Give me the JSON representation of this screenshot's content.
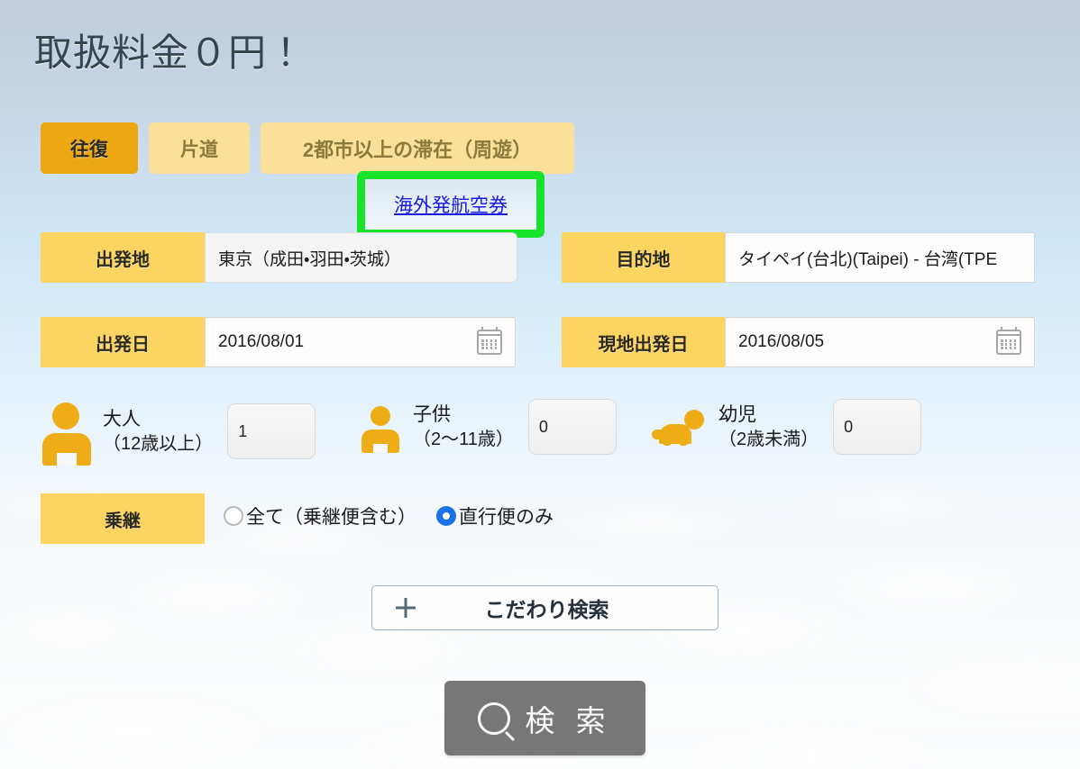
{
  "page": {
    "title": "取扱料金０円！"
  },
  "trip_tabs": [
    {
      "label": "往復",
      "active": true
    },
    {
      "label": "片道",
      "active": false
    },
    {
      "label": "2都市以上の滞在（周遊）",
      "active": false
    }
  ],
  "overseas_link": {
    "label": "海外発航空券",
    "highlight_color": "#17e32a",
    "link_color": "#1a1ae0"
  },
  "fields": {
    "origin": {
      "label": "出発地",
      "value": "東京（成田・羽田・茨城）"
    },
    "destination": {
      "label": "目的地",
      "value": "タイペイ(台北)(Taipei) - 台湾(TPE"
    },
    "departure_date": {
      "label": "出発日",
      "value": "2016/08/01",
      "icon": "calendar-icon"
    },
    "return_date": {
      "label": "現地出発日",
      "value": "2016/08/05",
      "icon": "calendar-icon"
    }
  },
  "passengers": [
    {
      "key": "adult",
      "line1": "大人",
      "line2": "（12歳以上）",
      "value": "1",
      "icon": "adult-person-icon"
    },
    {
      "key": "child",
      "line1": "子供",
      "line2": "（2〜11歳）",
      "value": "0",
      "icon": "child-person-icon"
    },
    {
      "key": "infant",
      "line1": "幼児",
      "line2": "（2歳未満）",
      "value": "0",
      "icon": "infant-baby-icon"
    }
  ],
  "transfer": {
    "label": "乗継",
    "options": [
      {
        "label": "全て（乗継便含む）",
        "selected": false
      },
      {
        "label": "直行便のみ",
        "selected": true
      }
    ],
    "selected_color": "#1b72e8"
  },
  "advanced_search": {
    "label": "こだわり検索",
    "icon": "plus-icon"
  },
  "search_button": {
    "label": "検 索",
    "icon": "search-icon",
    "color": "#777777"
  },
  "theme": {
    "tab_active": "#eda712",
    "tab_inactive": "#fbe09a",
    "label_yellow": "#fcd462",
    "title_color": "#36464f"
  }
}
